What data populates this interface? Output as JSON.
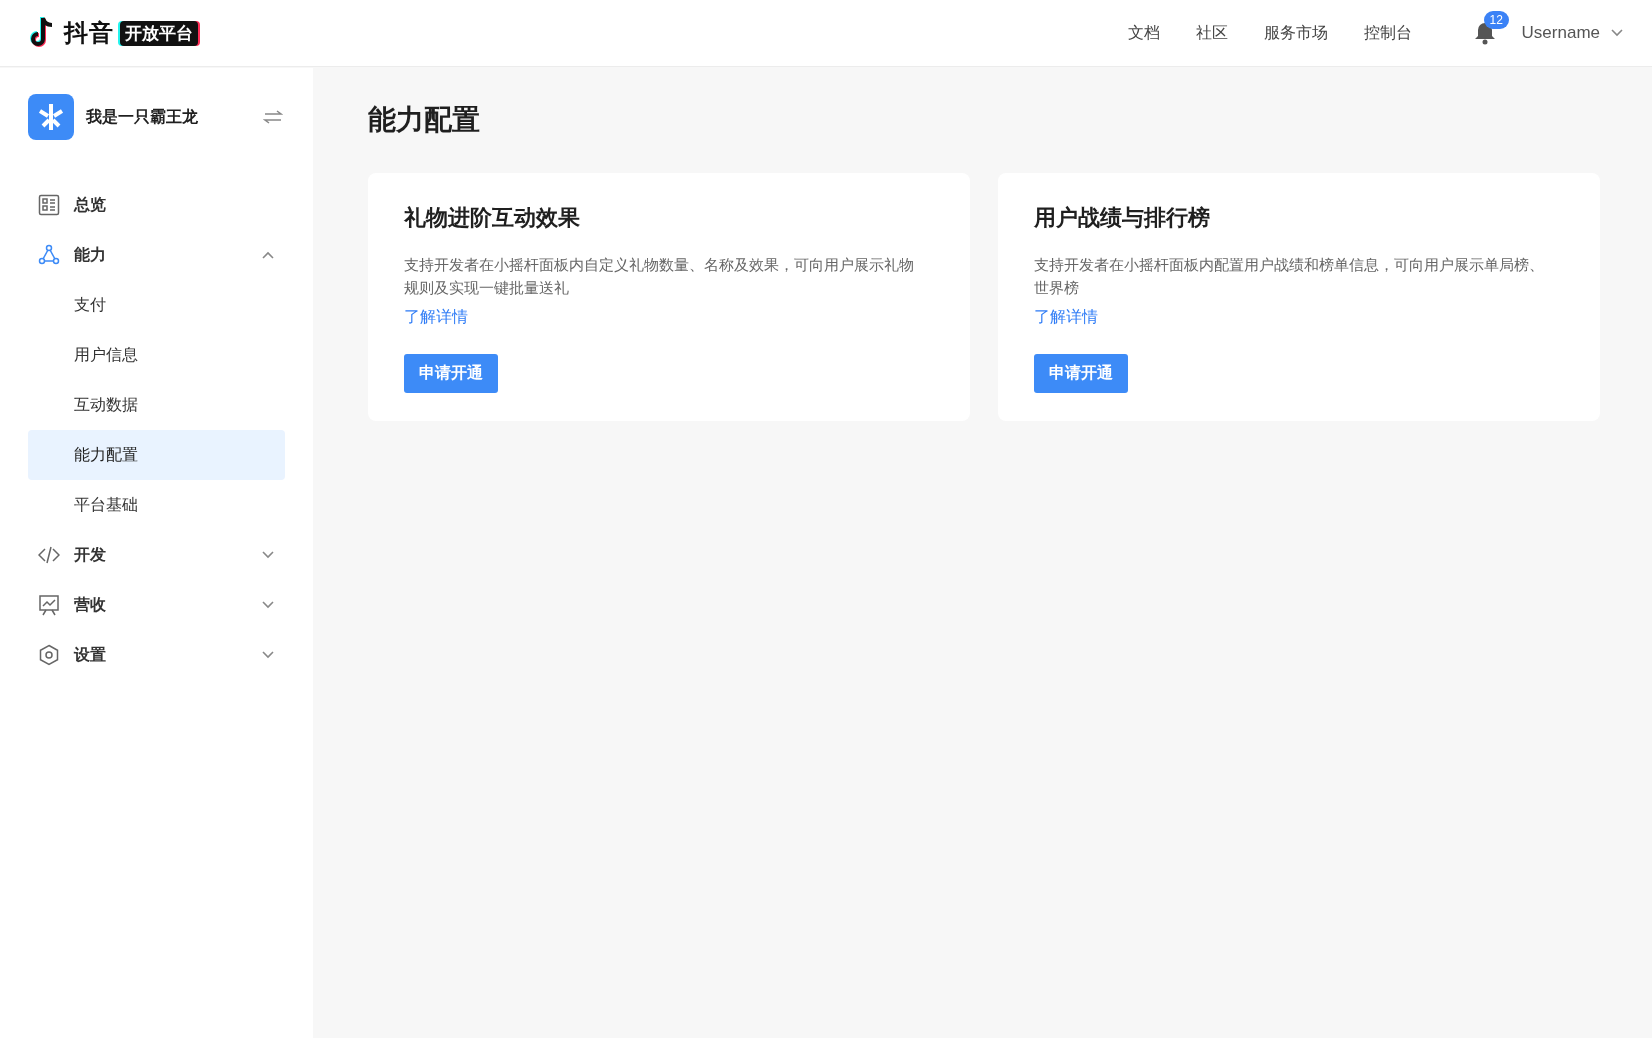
{
  "header": {
    "logo_text": "抖音",
    "logo_badge": "开放平台",
    "nav": [
      "文档",
      "社区",
      "服务市场",
      "控制台"
    ],
    "notification_count": "12",
    "username": "Username"
  },
  "sidebar": {
    "app_name": "我是一只霸王龙",
    "items": [
      {
        "label": "总览"
      },
      {
        "label": "能力",
        "expanded": true,
        "children": [
          {
            "label": "支付",
            "selected": false
          },
          {
            "label": "用户信息",
            "selected": false
          },
          {
            "label": "互动数据",
            "selected": false
          },
          {
            "label": "能力配置",
            "selected": true
          },
          {
            "label": "平台基础",
            "selected": false
          }
        ]
      },
      {
        "label": "开发",
        "expanded": false
      },
      {
        "label": "营收",
        "expanded": false
      },
      {
        "label": "设置",
        "expanded": false
      }
    ]
  },
  "page": {
    "title": "能力配置",
    "cards": [
      {
        "title": "礼物进阶互动效果",
        "description": "支持开发者在小摇杆面板内自定义礼物数量、名称及效果，可向用户展示礼物规则及实现一键批量送礼",
        "link": "了解详情",
        "button": "申请开通"
      },
      {
        "title": "用户战绩与排行榜",
        "description": "支持开发者在小摇杆面板内配置用户战绩和榜单信息，可向用户展示单局榜、世界榜",
        "link": "了解详情",
        "button": "申请开通"
      }
    ]
  }
}
